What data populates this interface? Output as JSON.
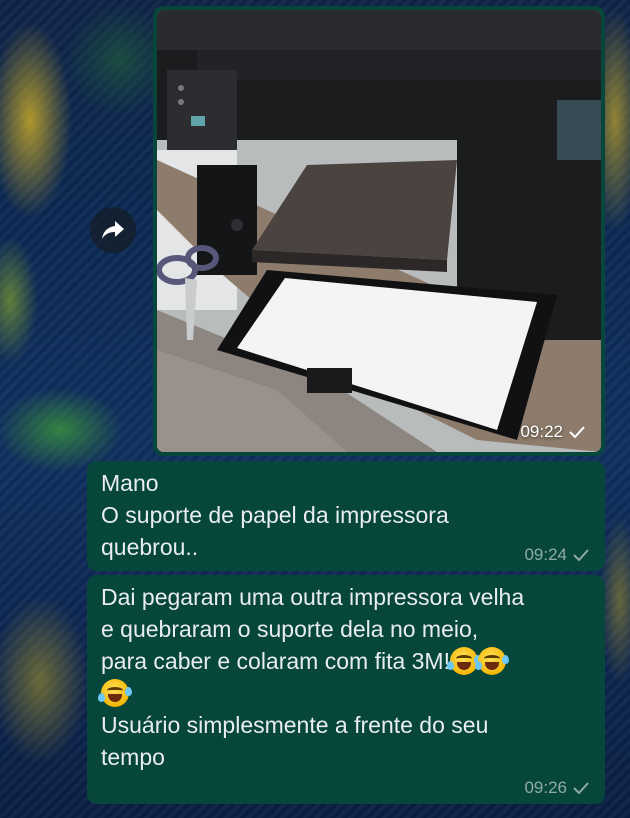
{
  "forward_button": {
    "icon": "forward-arrow-icon"
  },
  "messages": [
    {
      "type": "image",
      "image_description_icon": "printer-photo",
      "time": "09:22",
      "status_icon": "check-icon"
    },
    {
      "type": "text",
      "text": "Mano\nO suporte de papel da impressora\nquebrou..",
      "time": "09:24",
      "status_icon": "check-icon"
    },
    {
      "type": "text",
      "text_line1": "Dai pegaram uma outra impressora velha",
      "text_line2": "e quebraram o suporte dela no meio,",
      "text_line3": "para caber e colaram com fita 3M!",
      "text_line5": "Usuário simplesmente a frente do seu",
      "text_line6": "tempo",
      "emojis": [
        "rolling-on-floor-laughing",
        "rolling-on-floor-laughing",
        "rolling-on-floor-laughing"
      ],
      "time": "09:26",
      "status_icon": "check-icon"
    }
  ],
  "colors": {
    "bubble": "#06463b",
    "text": "#e9edef",
    "meta": "#9fb0ac"
  }
}
